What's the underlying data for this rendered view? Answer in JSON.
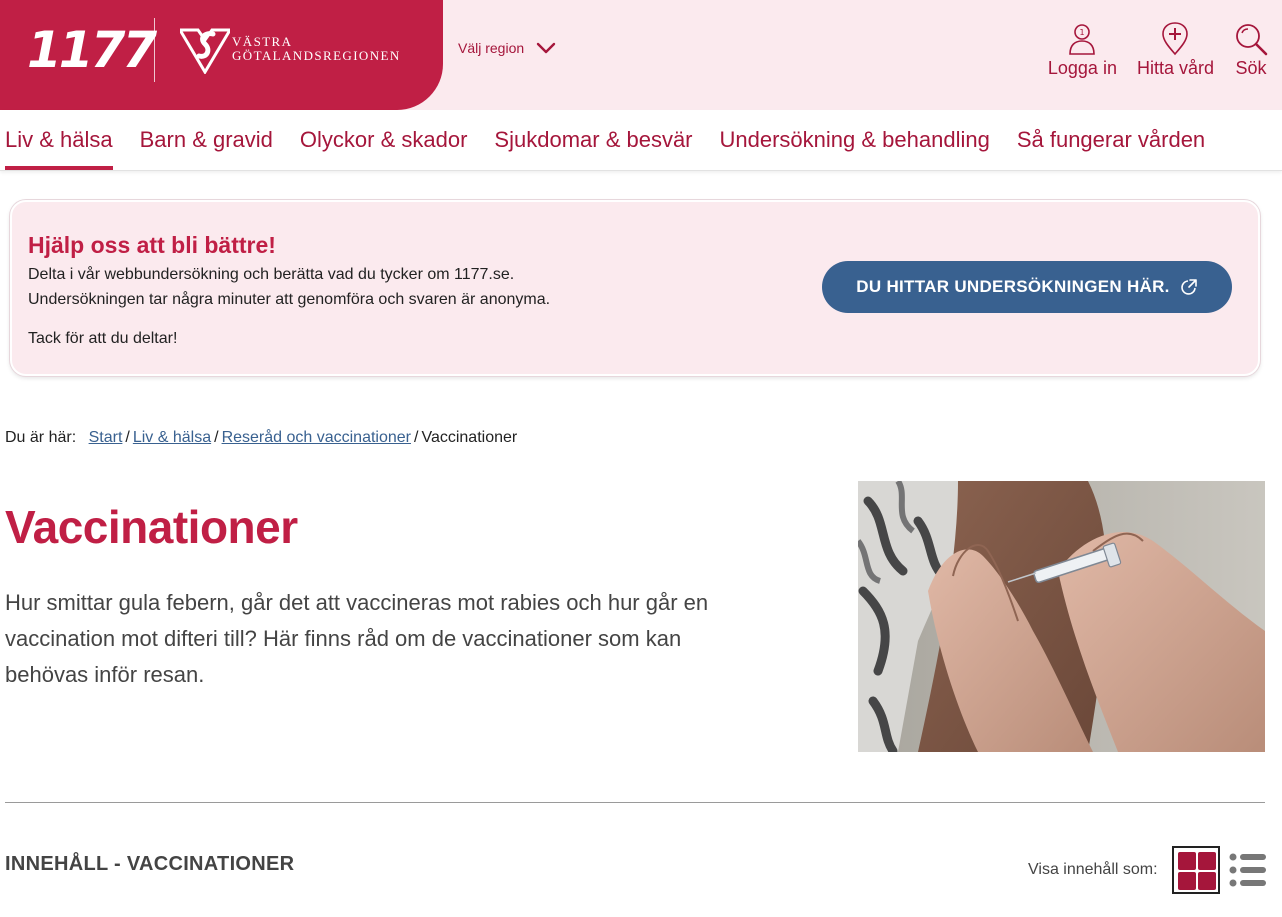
{
  "header": {
    "logo_text": "1177",
    "region_logo_lines": [
      "VÄSTRA",
      "GÖTALANDSREGIONEN"
    ],
    "region_select_label": "Välj region",
    "actions": [
      {
        "label": "Logga in",
        "icon": "person-icon"
      },
      {
        "label": "Hitta vård",
        "icon": "location-pin-plus-icon"
      },
      {
        "label": "Sök",
        "icon": "search-icon"
      }
    ]
  },
  "nav": {
    "items": [
      {
        "label": "Liv & hälsa",
        "active": true
      },
      {
        "label": "Barn & gravid"
      },
      {
        "label": "Olyckor & skador"
      },
      {
        "label": "Sjukdomar & besvär"
      },
      {
        "label": "Undersökning & behandling"
      },
      {
        "label": "Så fungerar vården"
      }
    ]
  },
  "banner": {
    "title": "Hjälp oss att bli bättre!",
    "text_line1": "Delta i vår webbundersökning och berätta vad du tycker om 1177.se.",
    "text_line2": "Undersökningen tar några minuter att genomföra och svaren är anonyma.",
    "thanks": "Tack för att du deltar!",
    "button_label": "DU HITTAR UNDERSÖKNINGEN HÄR."
  },
  "breadcrumb": {
    "lead": "Du är här:",
    "links": [
      "Start",
      "Liv & hälsa",
      "Reseråd och vaccinationer"
    ],
    "current": "Vaccinationer"
  },
  "page": {
    "title": "Vaccinationer",
    "intro": "Hur smittar gula febern, går det att vaccineras mot rabies och hur går en vaccination mot difteri till? Här finns råd om de vaccinationer som kan behövas inför resan."
  },
  "content": {
    "heading": "INNEHÅLL - VACCINATIONER",
    "view_label": "Visa innehåll som:"
  },
  "colors": {
    "brand": "#c01f45",
    "brand_dark": "#a5163b",
    "header_bg": "#fbeaee",
    "button_blue": "#396190",
    "link": "#396190"
  }
}
